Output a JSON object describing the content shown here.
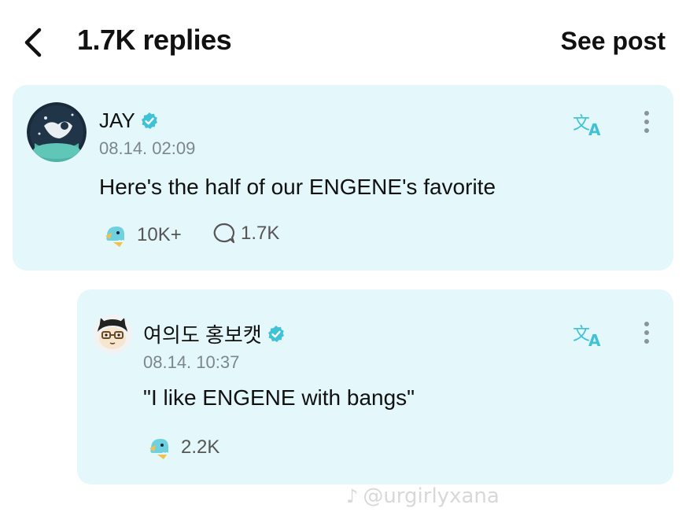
{
  "header": {
    "title": "1.7K replies",
    "see_post": "See post"
  },
  "posts": [
    {
      "author": "JAY",
      "timestamp": "08.14. 02:09",
      "text": "Here's the half of our ENGENE's favorite",
      "likes": "10K+",
      "replies": "1.7K",
      "avatar_icon": "jay-avatar"
    },
    {
      "author": "여의도 홍보캣",
      "timestamp": "08.14. 10:37",
      "text": "\"I like ENGENE with bangs\"",
      "likes": "2.2K",
      "avatar_icon": "cat-avatar"
    }
  ],
  "icons": {
    "back": "chevron-left-icon",
    "verified": "verified-badge-icon",
    "translate": "translate-icon",
    "more": "more-vertical-icon",
    "like": "ghost-like-icon",
    "comment": "comment-bubble-icon"
  },
  "watermark": {
    "text": "@urgirlyxana"
  },
  "colors": {
    "card_bg": "#e4f7fa",
    "accent": "#3ec2d6",
    "muted": "#7d878b"
  }
}
